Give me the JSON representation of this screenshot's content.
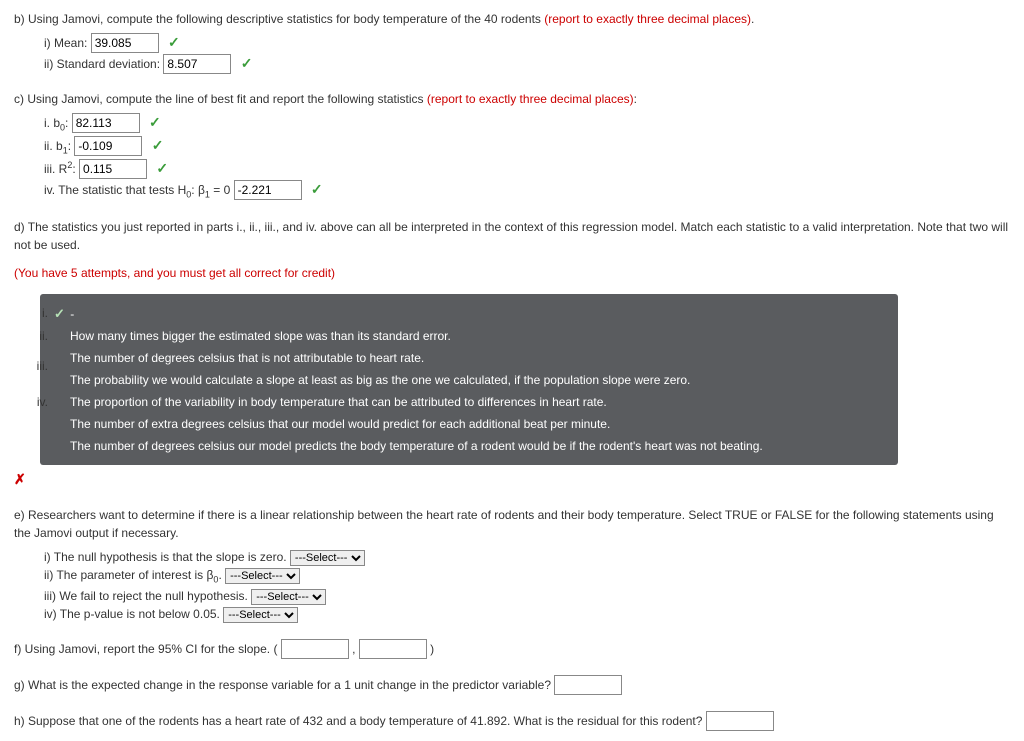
{
  "b": {
    "text_pre": "b) Using Jamovi, compute the following descriptive statistics for body temperature of the 40 rodents ",
    "text_red": "(report to exactly three decimal places)",
    "text_post": ".",
    "i_label": "i) Mean: ",
    "i_value": "39.085",
    "ii_label": "ii) Standard deviation: ",
    "ii_value": "8.507"
  },
  "c": {
    "text_pre": "c) Using Jamovi, compute the line of best fit and report the following statistics ",
    "text_red": "(report to exactly three decimal places)",
    "text_post": ":",
    "i_label_pre": "i. b",
    "i_sub": "0",
    "i_label_post": ": ",
    "i_value": "82.113",
    "ii_label_pre": "ii. b",
    "ii_sub": "1",
    "ii_label_post": ": ",
    "ii_value": "-0.109",
    "iii_label_pre": "iii. R",
    "iii_sup": "2",
    "iii_label_post": ": ",
    "iii_value": "0.115",
    "iv_label_pre": "iv. The statistic that tests H",
    "iv_sub0": "0",
    "iv_label_mid": ": β",
    "iv_sub1": "1",
    "iv_label_post": " = 0 ",
    "iv_value": "-2.221"
  },
  "d": {
    "text": "d) The statistics you just reported in parts i., ii., iii., and iv. above can all be interpreted in the context of this regression model. Match each statistic to a valid interpretation. Note that two will not be used.",
    "attempts": "(You have 5 attempts, and you must get all correct for credit)",
    "roman": {
      "i": "i.",
      "ii": "ii.",
      "iii": "iii.",
      "iv": "iv."
    },
    "selected": "-",
    "opt1": "How many times bigger the estimated slope was than its standard error.",
    "opt2": "The number of degrees celsius that is not attributable to heart rate.",
    "opt3": "The probability we would calculate a slope at least as big as the one we calculated, if the population slope were zero.",
    "opt4": "The proportion of the variability in body temperature that can be attributed to differences in heart rate.",
    "opt5": "The number of extra degrees celsius that our model would predict for each additional beat per minute.",
    "opt6": "The number of degrees celsius our model predicts the body temperature of a rodent would be if the rodent's heart was not beating."
  },
  "e": {
    "text": "e) Researchers want to determine if there is a linear relationship between the heart rate of rodents and their body temperature. Select TRUE or FALSE for the following statements using the Jamovi output if necessary.",
    "i": "i) The null hypothesis is that the slope is zero. ",
    "ii_pre": "ii) The parameter of interest is β",
    "ii_sub": "0",
    "ii_post": ". ",
    "iii": "iii) We fail to reject the null hypothesis. ",
    "iv": "iv) The p-value is not below 0.05. ",
    "select_placeholder": "---Select---"
  },
  "f": {
    "text": "f) Using Jamovi, report the 95% CI for the slope. ( ",
    "comma": " , ",
    "close": " )"
  },
  "g": {
    "text": "g) What is the expected change in the response variable for a 1 unit change in the predictor variable? "
  },
  "h": {
    "text": "h) Suppose that one of the rodents has a heart rate of 432 and a body temperature of 41.892. What is the residual for this rodent? "
  }
}
